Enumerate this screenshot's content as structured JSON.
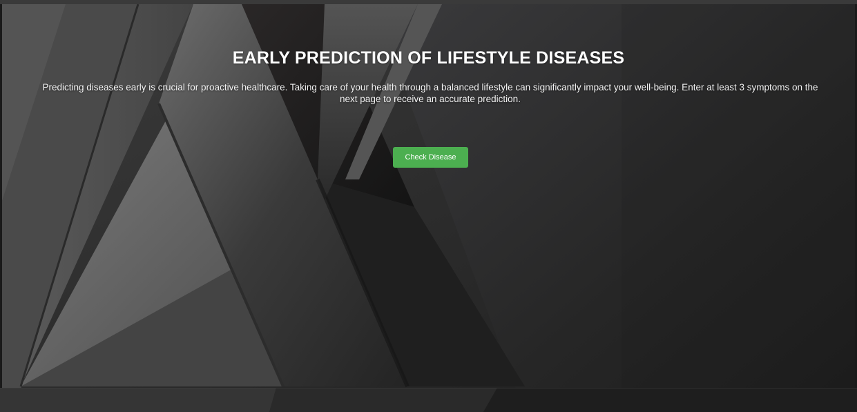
{
  "hero": {
    "title": "EARLY PREDICTION OF LIFESTYLE DISEASES",
    "description": "Predicting diseases early is crucial for proactive healthcare. Taking care of your health through a balanced lifestyle can significantly impact your well-being. Enter at least 3 symptoms on the next page to receive an accurate prediction.",
    "button_label": "Check Disease"
  },
  "colors": {
    "button": "#4caf50",
    "background": "#262626",
    "text": "#ffffff"
  }
}
